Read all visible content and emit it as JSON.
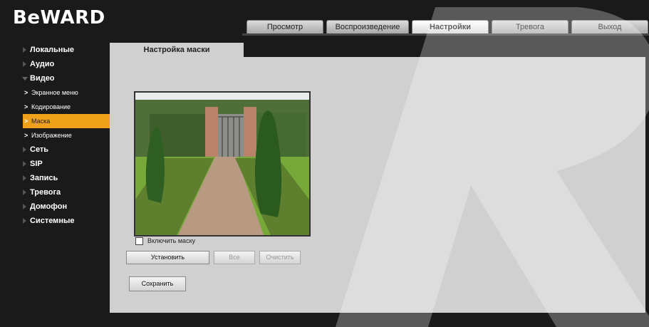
{
  "brand": {
    "logo_text": "BeWARD"
  },
  "tabs": [
    {
      "label": "Просмотр",
      "active": false
    },
    {
      "label": "Воспроизведение",
      "active": false
    },
    {
      "label": "Настройки",
      "active": true
    },
    {
      "label": "Тревога",
      "active": false
    },
    {
      "label": "Выход",
      "active": false
    }
  ],
  "sidebar": {
    "items": [
      {
        "label": "Локальные"
      },
      {
        "label": "Аудио"
      },
      {
        "label": "Видео",
        "expanded": true,
        "children": [
          {
            "label": "Экранное меню"
          },
          {
            "label": "Кодирование"
          },
          {
            "label": "Маска",
            "active": true
          },
          {
            "label": "Изображение"
          }
        ]
      },
      {
        "label": "Сеть"
      },
      {
        "label": "SIP"
      },
      {
        "label": "Запись"
      },
      {
        "label": "Тревога"
      },
      {
        "label": "Домофон"
      },
      {
        "label": "Системные"
      }
    ]
  },
  "panel": {
    "title": "Настройка маски",
    "enable_mask_label": "Включить маску",
    "enable_mask_checked": false,
    "buttons": {
      "set": "Установить",
      "all": "Все",
      "clear": "Очистить",
      "save": "Сохранить"
    }
  },
  "colors": {
    "accent": "#f0a11a",
    "panel_bg": "#d0d0d0",
    "page_bg": "#1a1a1a"
  }
}
